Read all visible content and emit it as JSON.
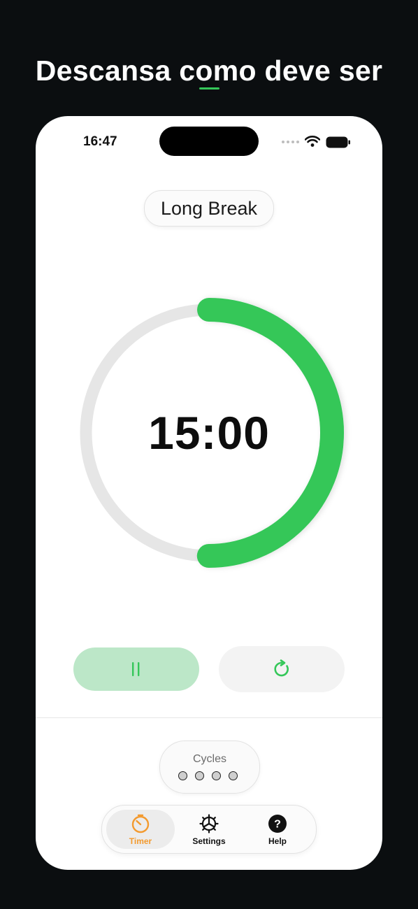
{
  "headline": "Descansa como deve ser",
  "colors": {
    "accent": "#34c759",
    "pause_bg": "#bce7c8",
    "timer_tab": "#f39a2e",
    "track": "#e6e6e6",
    "background": "#0b0e10"
  },
  "status_bar": {
    "time": "16:47",
    "icons": [
      "signal-dots-icon",
      "wifi-icon",
      "battery-icon"
    ]
  },
  "timer": {
    "mode": "Long Break",
    "time": "15:00",
    "progress": 0.5
  },
  "controls": {
    "pause_icon": "pause-icon",
    "reset_icon": "reset-icon"
  },
  "cycles": {
    "label": "Cycles",
    "completed": 0,
    "total": 4
  },
  "tabs": [
    {
      "label": "Timer",
      "icon": "timer-icon",
      "active": true
    },
    {
      "label": "Settings",
      "icon": "gear-icon",
      "active": false
    },
    {
      "label": "Help",
      "icon": "help-icon",
      "active": false
    }
  ]
}
